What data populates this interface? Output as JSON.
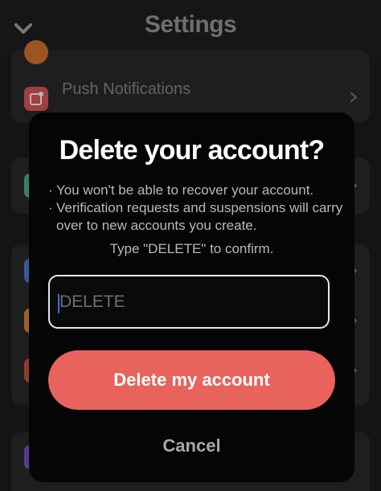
{
  "header": {
    "title": "Settings",
    "back_icon": "chevron-down-icon"
  },
  "settings_list": {
    "push_notifications_label": "Push Notifications",
    "push_notifications_icon": "notification-badge-icon"
  },
  "dialog": {
    "title": "Delete your account?",
    "bullets": [
      "You won't be able to recover your account.",
      "Verification requests and suspensions will carry over to new accounts you create."
    ],
    "confirm_hint": "Type \"DELETE\" to confirm.",
    "input": {
      "placeholder": "DELETE",
      "value": ""
    },
    "delete_button_label": "Delete my account",
    "cancel_button_label": "Cancel"
  },
  "colors": {
    "accent_danger": "#e8635c",
    "dialog_bg": "#050505",
    "page_bg": "#1c1c1c",
    "icon_orange": "#d9762f",
    "icon_red": "#e0575a",
    "icon_green": "#4ab58a",
    "icon_blue": "#4a7bd9",
    "icon_amber": "#d98b3a",
    "icon_brick": "#c7553d",
    "icon_purple": "#7a4fd1"
  }
}
